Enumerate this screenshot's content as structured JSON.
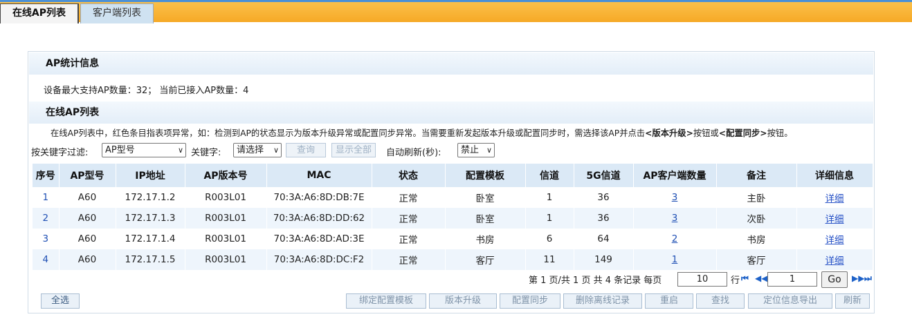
{
  "tabs": [
    {
      "label": "在线AP列表",
      "active": true
    },
    {
      "label": "客户端列表",
      "active": false
    }
  ],
  "stats": {
    "title": "AP统计信息",
    "line": "设备最大支持AP数量：32；  当前已接入AP数量：4"
  },
  "list": {
    "title": "在线AP列表",
    "note_pre": "在线AP列表中，红色条目指表项异常，如：检测到AP的状态显示为版本升级异常或配置同步异常。当需要重新发起版本升级或配置同步时，需选择该AP并点击",
    "note_b1": "<版本升级>",
    "note_mid": "按钮或",
    "note_b2": "<配置同步>",
    "note_post": "按钮。"
  },
  "filter": {
    "label": "按关键字过滤:",
    "field_value": "AP型号",
    "keyword_label": "关键字:",
    "keyword_value": "请选择",
    "search_label": "查询",
    "show_all_label": "显示全部",
    "refresh_label": "自动刷新(秒):",
    "refresh_value": "禁止"
  },
  "table": {
    "headers": [
      "序号",
      "AP型号",
      "IP地址",
      "AP版本号",
      "MAC",
      "状态",
      "配置模板",
      "信道",
      "5G信道",
      "AP客户端数量",
      "备注",
      "详细信息"
    ],
    "rows": [
      {
        "idx": "1",
        "model": "A60",
        "ip": "172.17.1.2",
        "ver": "R003L01",
        "mac": "70:3A:A6:8D:DB:7E",
        "status": "正常",
        "tpl": "卧室",
        "ch": "1",
        "ch5g": "36",
        "clients": "3",
        "remark": "主卧",
        "detail": "详细"
      },
      {
        "idx": "2",
        "model": "A60",
        "ip": "172.17.1.3",
        "ver": "R003L01",
        "mac": "70:3A:A6:8D:DD:62",
        "status": "正常",
        "tpl": "卧室",
        "ch": "1",
        "ch5g": "36",
        "clients": "3",
        "remark": "次卧",
        "detail": "详细"
      },
      {
        "idx": "3",
        "model": "A60",
        "ip": "172.17.1.4",
        "ver": "R003L01",
        "mac": "70:3A:A6:8D:AD:3E",
        "status": "正常",
        "tpl": "书房",
        "ch": "6",
        "ch5g": "64",
        "clients": "2",
        "remark": "书房",
        "detail": "详细"
      },
      {
        "idx": "4",
        "model": "A60",
        "ip": "172.17.1.5",
        "ver": "R003L01",
        "mac": "70:3A:A6:8D:DC:F2",
        "status": "正常",
        "tpl": "客厅",
        "ch": "11",
        "ch5g": "149",
        "clients": "1",
        "remark": "客厅",
        "detail": "详细"
      }
    ]
  },
  "pager": {
    "summary": "第 1 页/共 1 页 共 4 条记录 每页",
    "per_page": "10",
    "row_label": "行",
    "page_input": "1",
    "go_label": "Go"
  },
  "buttons": {
    "select_all": "全选",
    "bind_template": "绑定配置模板",
    "upgrade": "版本升级",
    "sync": "配置同步",
    "delete_offline": "删除离线记录",
    "reboot": "重启",
    "locate": "查找",
    "export": "定位信息导出",
    "refresh": "刷新"
  },
  "colors": {
    "topbar": "#f6a926",
    "header_bg": "#dbe9f6",
    "link": "#1e4fb4"
  }
}
